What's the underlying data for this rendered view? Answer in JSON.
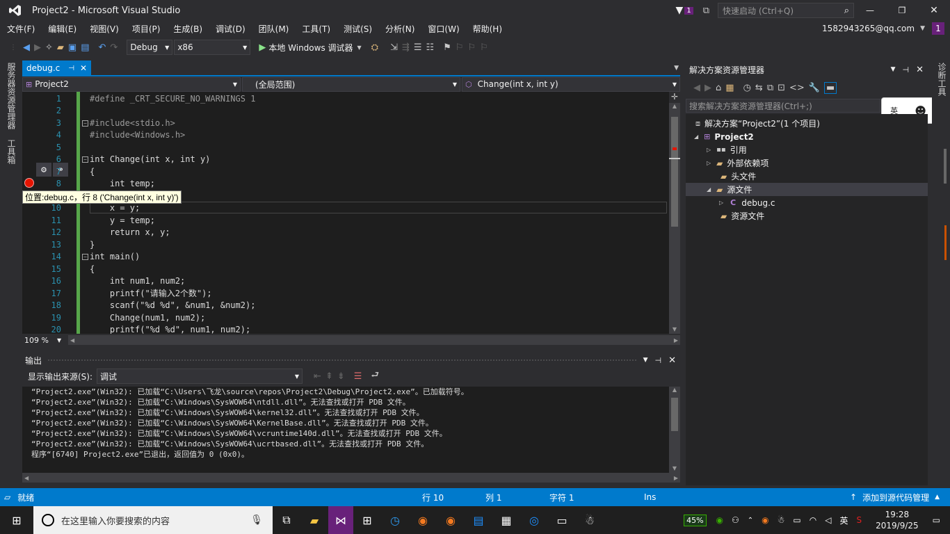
{
  "window": {
    "title": "Project2 - Microsoft Visual Studio",
    "notif_count": "1",
    "quick_launch_placeholder": "快速启动 (Ctrl+Q)",
    "account": "1582943265@qq.com",
    "account_badge": "1"
  },
  "menu": [
    "文件(F)",
    "编辑(E)",
    "视图(V)",
    "项目(P)",
    "生成(B)",
    "调试(D)",
    "团队(M)",
    "工具(T)",
    "测试(S)",
    "分析(N)",
    "窗口(W)",
    "帮助(H)"
  ],
  "toolbar": {
    "config": "Debug",
    "platform": "x86",
    "run_label": "本地 Windows 调试器"
  },
  "left_rail": {
    "tab1": "服务器资源管理器",
    "tab2": "工具箱"
  },
  "right_rail": {
    "tab1": "诊断工具"
  },
  "editor": {
    "tab_label": "debug.c",
    "nav_project": "Project2",
    "nav_scope": "(全局范围)",
    "nav_member": "Change(int x, int y)",
    "zoom": "109 %",
    "tooltip": "位置:debug.c，行 8 ('Change(int x, int y)')",
    "lines": [
      {
        "n": "1",
        "text": "#define _CRT_SECURE_NO_WARNINGS 1"
      },
      {
        "n": "2",
        "text": ""
      },
      {
        "n": "3",
        "text": "#include<stdio.h>"
      },
      {
        "n": "4",
        "text": "#include<Windows.h>"
      },
      {
        "n": "5",
        "text": ""
      },
      {
        "n": "6",
        "text": "int Change(int x, int y)"
      },
      {
        "n": "7",
        "text": "{"
      },
      {
        "n": "8",
        "text": "    int temp;"
      },
      {
        "n": "9",
        "text": ""
      },
      {
        "n": "10",
        "text": "    x = y;"
      },
      {
        "n": "11",
        "text": "    y = temp;"
      },
      {
        "n": "12",
        "text": "    return x, y;"
      },
      {
        "n": "13",
        "text": "}"
      },
      {
        "n": "14",
        "text": "int main()"
      },
      {
        "n": "15",
        "text": "{"
      },
      {
        "n": "16",
        "text": "    int num1, num2;"
      },
      {
        "n": "17",
        "text": "    printf(\"请输入2个数\");"
      },
      {
        "n": "18",
        "text": "    scanf(\"%d %d\", &num1, &num2);"
      },
      {
        "n": "19",
        "text": "    Change(num1, num2);"
      },
      {
        "n": "20",
        "text": "    printf(\"%d %d\", num1, num2);"
      }
    ]
  },
  "output": {
    "title": "输出",
    "source_label": "显示输出来源(S):",
    "source_value": "调试",
    "lines": [
      "“Project2.exe”(Win32): 已加载“C:\\Users\\飞龙\\source\\repos\\Project2\\Debug\\Project2.exe”。已加载符号。",
      "“Project2.exe”(Win32): 已加载“C:\\Windows\\SysWOW64\\ntdll.dll”。无法查找或打开 PDB 文件。",
      "“Project2.exe”(Win32): 已加载“C:\\Windows\\SysWOW64\\kernel32.dll”。无法查找或打开 PDB 文件。",
      "“Project2.exe”(Win32): 已加载“C:\\Windows\\SysWOW64\\KernelBase.dll”。无法查找或打开 PDB 文件。",
      "“Project2.exe”(Win32): 已加载“C:\\Windows\\SysWOW64\\vcruntime140d.dll”。无法查找或打开 PDB 文件。",
      "“Project2.exe”(Win32): 已加载“C:\\Windows\\SysWOW64\\ucrtbased.dll”。无法查找或打开 PDB 文件。",
      "程序“[6740] Project2.exe”已退出，返回值为 0 (0x0)。"
    ]
  },
  "solution": {
    "title": "解决方案资源管理器",
    "search_placeholder": "搜索解决方案资源管理器(Ctrl+;)",
    "ime_badge": "英",
    "solution_label": "解决方案“Project2”(1 个项目)",
    "project": "Project2",
    "references": "引用",
    "external": "外部依赖项",
    "headers": "头文件",
    "sources": "源文件",
    "file": "debug.c",
    "resources": "资源文件"
  },
  "status": {
    "ready": "就绪",
    "line": "行 10",
    "col": "列 1",
    "char": "字符 1",
    "ins": "Ins",
    "source_control": "添加到源代码管理"
  },
  "taskbar": {
    "search_placeholder": "在这里输入你要搜索的内容",
    "battery": "45%",
    "ime": "英",
    "time": "19:28",
    "date": "2019/9/25"
  },
  "colors": {
    "accent": "#007acc",
    "breakpoint": "#e51400",
    "keyword": "#569cd6",
    "string": "#d69d85",
    "macro": "#beb7ff"
  }
}
